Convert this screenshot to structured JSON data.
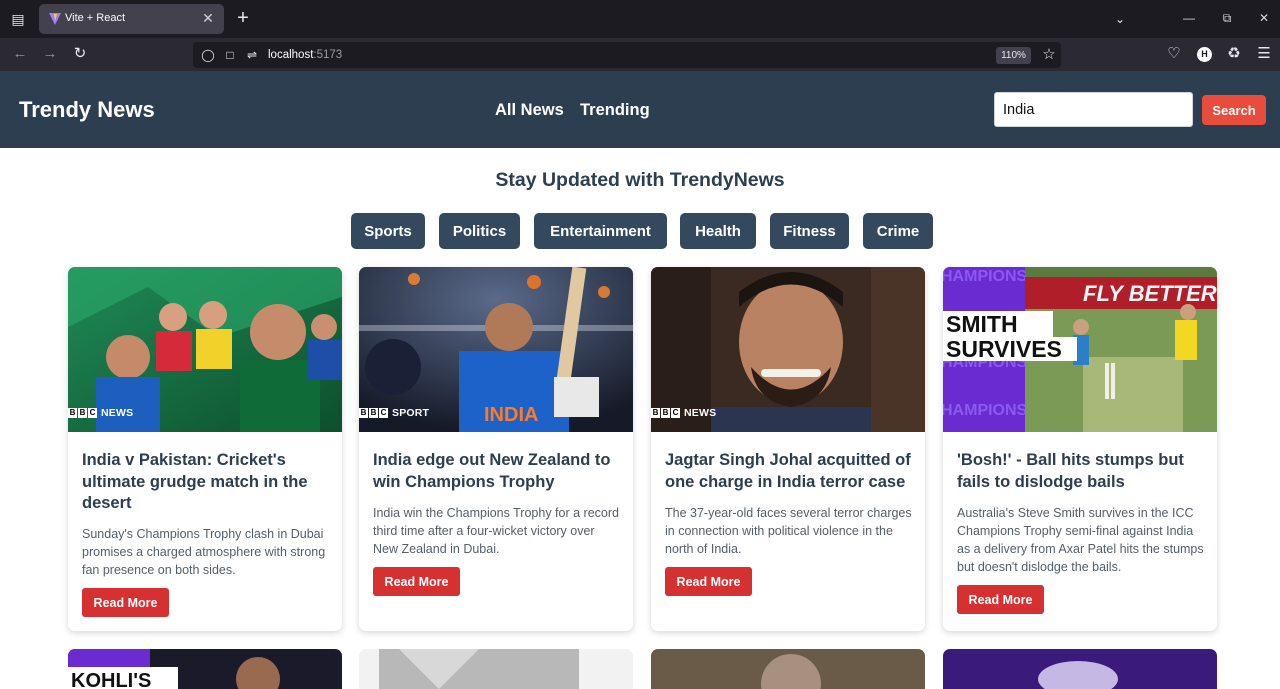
{
  "browser": {
    "tab_title": "Vite + React",
    "url_host": "localhost",
    "url_port": ":5173",
    "zoom": "110%",
    "profile_initial": "H"
  },
  "header": {
    "brand": "Trendy News",
    "nav": [
      "All News",
      "Trending"
    ],
    "search_value": "India",
    "search_button": "Search"
  },
  "main": {
    "tagline": "Stay Updated with TrendyNews",
    "categories": [
      "Sports",
      "Politics",
      "Entertainment",
      "Health",
      "Fitness",
      "Crime"
    ],
    "cards": [
      {
        "title": "India v Pakistan: Cricket's ultimate grudge match in the desert",
        "description": "Sunday's Champions Trophy clash in Dubai promises a charged atmosphere with strong fan presence on both sides.",
        "button": "Read More",
        "source_badge": "NEWS"
      },
      {
        "title": "India edge out New Zealand to win Champions Trophy",
        "description": "India win the Champions Trophy for a record third time after a four-wicket victory over New Zealand in Dubai.",
        "button": "Read More",
        "source_badge": "SPORT",
        "image_text": "INDIA"
      },
      {
        "title": "Jagtar Singh Johal acquitted of one charge in India terror case",
        "description": "The 37-year-old faces several terror charges in connection with political violence in the north of India.",
        "button": "Read More",
        "source_badge": "NEWS"
      },
      {
        "title": "'Bosh!' - Ball hits stumps but fails to dislodge bails",
        "description": "Australia's Steve Smith survives in the ICC Champions Trophy semi-final against India as a delivery from Axar Patel hits the stumps but doesn't dislodge the bails.",
        "button": "Read More",
        "image_headline_1": "SMITH",
        "image_headline_2": "SURVIVES",
        "image_banner": "FLY BETTER",
        "image_side": "HAMPIONS"
      }
    ],
    "partial_text": "KOHLI'S"
  },
  "colors": {
    "header_bg": "#2c3e50",
    "category_bg": "#34495e",
    "search_btn": "#e74c3c",
    "read_more": "#d63031"
  }
}
